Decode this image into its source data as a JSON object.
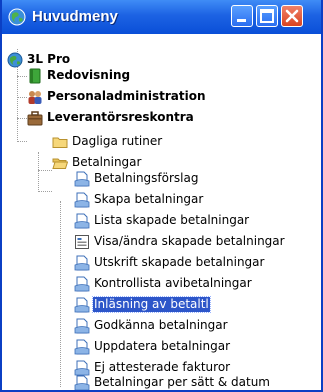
{
  "window": {
    "title": "Huvudmeny",
    "icon": "app-globe-icon",
    "controls": [
      "minimize-icon",
      "maximize-icon",
      "close-icon"
    ]
  },
  "tree": {
    "root": {
      "label": "3L Pro",
      "icon": "globe-icon"
    },
    "modules": [
      {
        "label": "Redovisning",
        "icon": "green-book-icon"
      },
      {
        "label": "Personaladministration",
        "icon": "people-icon"
      },
      {
        "label": "Leverantörsreskontra",
        "icon": "briefcase-icon",
        "expanded": true
      }
    ],
    "folders": [
      {
        "label": "Dagliga rutiner",
        "icon": "folder-icon"
      },
      {
        "label": "Betalningar",
        "icon": "folder-open-icon",
        "expanded": true
      }
    ],
    "items": [
      {
        "label": "Betalningsförslag",
        "icon": "document-icon"
      },
      {
        "label": "Skapa betalningar",
        "icon": "document-icon"
      },
      {
        "label": "Lista skapade betalningar",
        "icon": "document-icon"
      },
      {
        "label": "Visa/ändra skapade betalningar",
        "icon": "form-icon"
      },
      {
        "label": "Utskrift skapade betalningar",
        "icon": "document-icon"
      },
      {
        "label": "Kontrollista avibetalningar",
        "icon": "document-icon"
      },
      {
        "label": "Inläsning av betaltl",
        "icon": "document-icon",
        "selected": true
      },
      {
        "label": "Godkänna betalningar",
        "icon": "document-icon"
      },
      {
        "label": "Uppdatera betalningar",
        "icon": "document-icon"
      },
      {
        "label": "Ej attesterade fakturor",
        "icon": "document-icon"
      },
      {
        "label": "Betalningar per sätt & datum",
        "icon": "document-icon"
      }
    ],
    "selection_color": "#2d56c9"
  }
}
